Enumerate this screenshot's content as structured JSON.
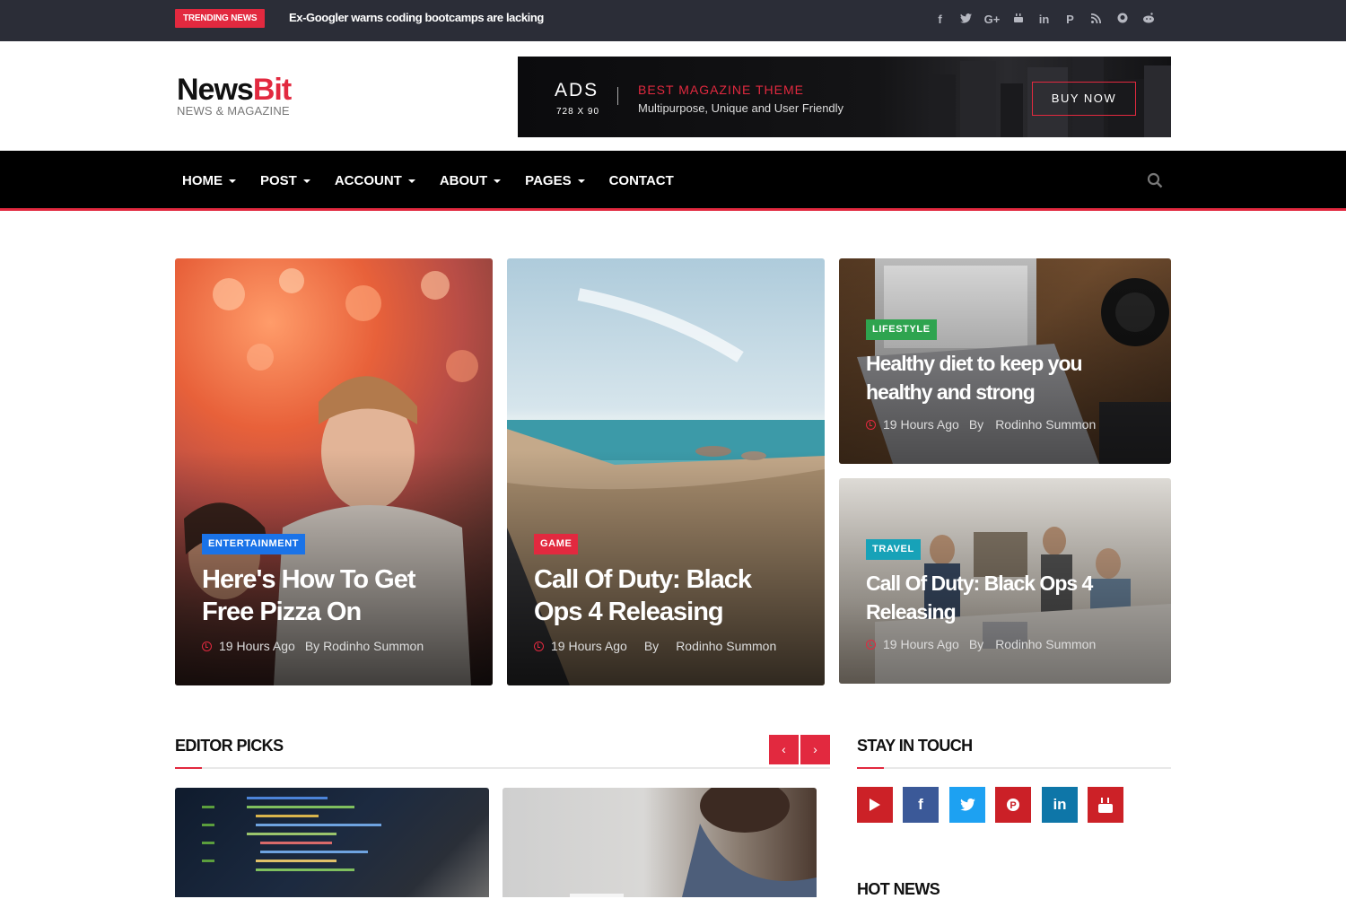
{
  "topbar": {
    "trending_label": "TRENDING NEWS",
    "trending_headline": "Ex-Googler warns coding bootcamps are lacking",
    "social_icons": [
      "facebook-icon",
      "twitter-icon",
      "google-plus-icon",
      "youtube-icon",
      "linkedin-icon",
      "pinterest-icon",
      "rss-icon",
      "github-icon",
      "reddit-icon"
    ]
  },
  "logo": {
    "name_part1": "News",
    "name_part2": "Bit",
    "tagline": "NEWS & MAGAZINE"
  },
  "ad": {
    "label": "ADS",
    "size": "728 X 90",
    "headline": "BEST MAGAZINE THEME",
    "tagline": "Multipurpose, Unique and User Friendly",
    "button": "BUY NOW"
  },
  "nav": {
    "items": [
      {
        "label": "HOME"
      },
      {
        "label": "POST"
      },
      {
        "label": "ACCOUNT"
      },
      {
        "label": "ABOUT"
      },
      {
        "label": "PAGES"
      },
      {
        "label": "CONTACT"
      }
    ]
  },
  "featured": [
    {
      "category": "ENTERTAINMENT",
      "title_l1": "Here's How To Get",
      "title_l2": "Free Pizza On",
      "time": "19 Hours Ago",
      "by": "By Rodinho Summon",
      "author": "",
      "cat_color": "#1a73e8"
    },
    {
      "category": "GAME",
      "title_l1": "Call Of Duty: Black",
      "title_l2": "Ops 4 Releasing",
      "time": "19 Hours Ago",
      "by": "By",
      "author": "Rodinho Summon",
      "cat_color": "#e2293f"
    },
    {
      "category": "LIFESTYLE",
      "title_l1": "Healthy diet to keep you",
      "title_l2": "healthy and strong",
      "time": "19 Hours Ago",
      "by": "By",
      "author": "Rodinho Summon",
      "cat_color": "#2ea44f"
    },
    {
      "category": "TRAVEL",
      "title_l1": "Call Of Duty: Black Ops 4",
      "title_l2": "Releasing",
      "time": "19 Hours Ago",
      "by": "By",
      "author": "Rodinho Summon",
      "cat_color": "#17a2b8"
    }
  ],
  "editor_picks": {
    "title": "EDITOR PICKS",
    "prev": "‹",
    "next": "›"
  },
  "stay_in_touch": {
    "title": "STAY IN TOUCH",
    "icons": [
      "youtube-icon",
      "facebook-icon",
      "twitter-icon",
      "pinterest-icon",
      "linkedin-icon",
      "youtube-text-icon"
    ],
    "colors": [
      "#cc2127",
      "#3b5998",
      "#1da1f2",
      "#cb2027",
      "#0e76a8",
      "#cc2127"
    ]
  },
  "hot_news": {
    "title": "HOT NEWS"
  }
}
